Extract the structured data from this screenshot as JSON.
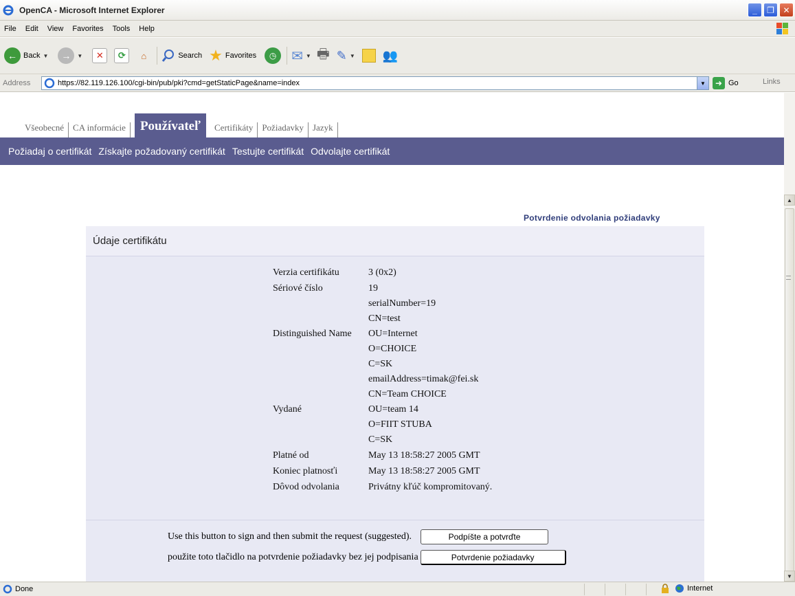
{
  "window": {
    "title": "OpenCA - Microsoft Internet Explorer"
  },
  "menu": [
    "File",
    "Edit",
    "View",
    "Favorites",
    "Tools",
    "Help"
  ],
  "toolbar": {
    "back": "Back",
    "search": "Search",
    "favorites": "Favorites"
  },
  "address": {
    "label": "Address",
    "url": "https://82.119.126.100/cgi-bin/pub/pki?cmd=getStaticPage&name=index",
    "go": "Go",
    "links": "Links"
  },
  "tabs": [
    "Všeobecné",
    "CA informácie",
    "Používateľ",
    "Certifikáty",
    "Požiadavky",
    "Jazyk"
  ],
  "subnav": [
    "Požiadaj o certifikát",
    "Získajte požadovaný certifikát",
    "Testujte certifikát",
    "Odvolajte certifikát"
  ],
  "page": {
    "confirm_title": "Potvrdenie odvolania požiadavky",
    "panel_title": "Údaje certifikátu",
    "version": {
      "label": "Verzia certifikátu",
      "value": "3 (0x2)"
    },
    "serial": {
      "label": "Sériové číslo",
      "value": "19"
    },
    "dn": {
      "label": "Distinguished Name",
      "values": [
        "serialNumber=19",
        "CN=test",
        "OU=Internet",
        "O=CHOICE",
        "C=SK"
      ]
    },
    "issuer": {
      "label": "Vydané",
      "values": [
        "emailAddress=timak@fei.sk",
        "CN=Team CHOICE",
        "OU=team 14",
        "O=FIIT STUBA",
        "C=SK"
      ]
    },
    "valid_from": {
      "label": "Platné od",
      "value": "May 13 18:58:27 2005 GMT"
    },
    "valid_to": {
      "label": "Koniec platnosťi",
      "value": "May 13 18:58:27 2005 GMT"
    },
    "reason": {
      "label": "Dôvod odvolania",
      "value": "Privátny kľúč kompromitovaný."
    },
    "sign_text": "Use this button to sign and then submit the request (suggested).",
    "sign_button": "Podpíšte a potvrďte",
    "nosign_text": "použite toto tlačidlo na potvrdenie požiadavky bez jej podpisania",
    "confirm_button": "Potvrdenie požiadavky"
  },
  "status": {
    "text": "Done",
    "zone": "Internet"
  },
  "colors": {
    "nav_bg": "#5a5c8f",
    "panel_bg": "#e8e9f4",
    "title_link": "#2f3d7a"
  }
}
